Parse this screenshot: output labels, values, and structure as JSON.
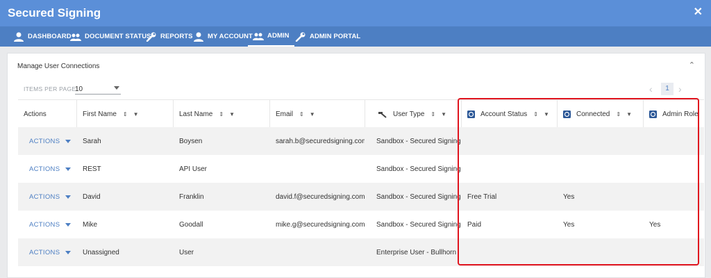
{
  "app": {
    "title": "Secured Signing",
    "close_glyph": "✕"
  },
  "nav": {
    "items": [
      {
        "label": "DASHBOARD",
        "icon": "person-icon"
      },
      {
        "label": "DOCUMENT STATUS",
        "icon": "people-icon"
      },
      {
        "label": "REPORTS",
        "icon": "wrench-icon"
      },
      {
        "label": "MY ACCOUNT",
        "icon": "person-icon"
      },
      {
        "label": "ADMIN",
        "icon": "people-icon",
        "active": true
      },
      {
        "label": "ADMIN PORTAL",
        "icon": "wrench-icon"
      }
    ]
  },
  "panel": {
    "title": "Manage User Connections",
    "collapse_glyph": "⌃",
    "items_per_page_label": "ITEMS PER PAGE:",
    "items_per_page_value": "10",
    "pager": {
      "prev": "‹",
      "page": "1",
      "next": "›"
    }
  },
  "table": {
    "columns": {
      "actions": "Actions",
      "first_name": "First Name",
      "last_name": "Last Name",
      "email": "Email",
      "user_type": "User Type",
      "account_status": "Account Status",
      "connected": "Connected",
      "admin_role": "Admin Role"
    },
    "sort_glyph": "⇕",
    "filter_glyph": "▼",
    "action_label": "ACTIONS",
    "rows": [
      {
        "first_name": "Sarah",
        "last_name": "Boysen",
        "email": "sarah.b@securedsigning.com",
        "user_type": "Sandbox - Secured Signing A...",
        "account_status": "",
        "connected": "",
        "admin_role": ""
      },
      {
        "first_name": "REST",
        "last_name": "API User",
        "email": "",
        "user_type": "Sandbox - Secured Signing R...",
        "account_status": "",
        "connected": "",
        "admin_role": ""
      },
      {
        "first_name": "David",
        "last_name": "Franklin",
        "email": "david.f@securedsigning.com",
        "user_type": "Sandbox - Secured Signing St...",
        "account_status": "Free Trial",
        "connected": "Yes",
        "admin_role": ""
      },
      {
        "first_name": "Mike",
        "last_name": "Goodall",
        "email": "mike.g@securedsigning.com",
        "user_type": "Sandbox - Secured Signing A...",
        "account_status": "Paid",
        "connected": "Yes",
        "admin_role": "Yes"
      },
      {
        "first_name": "Unassigned",
        "last_name": "User",
        "email": "",
        "user_type": "Enterprise User - Bullhorn",
        "account_status": "",
        "connected": "",
        "admin_role": ""
      }
    ]
  },
  "colors": {
    "titlebar": "#5b8fd8",
    "navbar": "#4d7fc3",
    "link": "#4d7fc3",
    "highlight": "#e0141e"
  }
}
